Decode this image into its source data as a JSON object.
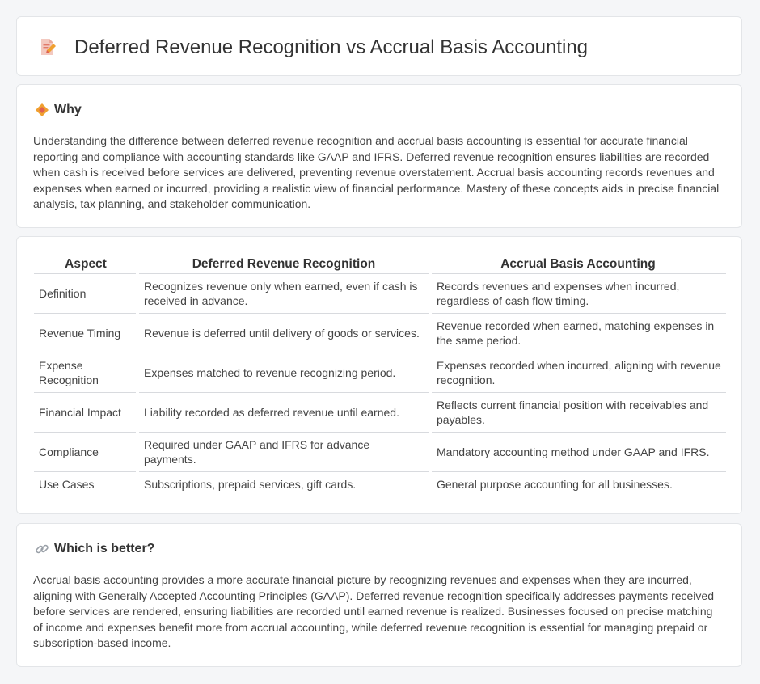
{
  "header": {
    "title": "Deferred Revenue Recognition vs Accrual Basis Accounting",
    "icon": "document-edit-icon"
  },
  "why": {
    "heading": "Why",
    "icon": "diamond-icon",
    "text": "Understanding the difference between deferred revenue recognition and accrual basis accounting is essential for accurate financial reporting and compliance with accounting standards like GAAP and IFRS. Deferred revenue recognition ensures liabilities are recorded when cash is received before services are delivered, preventing revenue overstatement. Accrual basis accounting records revenues and expenses when earned or incurred, providing a realistic view of financial performance. Mastery of these concepts aids in precise financial analysis, tax planning, and stakeholder communication."
  },
  "comparison": {
    "headers": [
      "Aspect",
      "Deferred Revenue Recognition",
      "Accrual Basis Accounting"
    ],
    "rows": [
      [
        "Definition",
        "Recognizes revenue only when earned, even if cash is received in advance.",
        "Records revenues and expenses when incurred, regardless of cash flow timing."
      ],
      [
        "Revenue Timing",
        "Revenue is deferred until delivery of goods or services.",
        "Revenue recorded when earned, matching expenses in the same period."
      ],
      [
        "Expense Recognition",
        "Expenses matched to revenue recognizing period.",
        "Expenses recorded when incurred, aligning with revenue recognition."
      ],
      [
        "Financial Impact",
        "Liability recorded as deferred revenue until earned.",
        "Reflects current financial position with receivables and payables."
      ],
      [
        "Compliance",
        "Required under GAAP and IFRS for advance payments.",
        "Mandatory accounting method under GAAP and IFRS."
      ],
      [
        "Use Cases",
        "Subscriptions, prepaid services, gift cards.",
        "General purpose accounting for all businesses."
      ]
    ]
  },
  "better": {
    "heading": "Which is better?",
    "icon": "link-icon",
    "text": "Accrual basis accounting provides a more accurate financial picture by recognizing revenues and expenses when they are incurred, aligning with Generally Accepted Accounting Principles (GAAP). Deferred revenue recognition specifically addresses payments received before services are rendered, ensuring liabilities are recorded until earned revenue is realized. Businesses focused on precise matching of income and expenses benefit more from accrual accounting, while deferred revenue recognition is essential for managing prepaid or subscription-based income."
  },
  "colors": {
    "background": "#f5f6f8",
    "card": "#ffffff",
    "border": "#e3e5e8",
    "accent_orange": "#f0a030",
    "icon_red": "#e06050"
  }
}
